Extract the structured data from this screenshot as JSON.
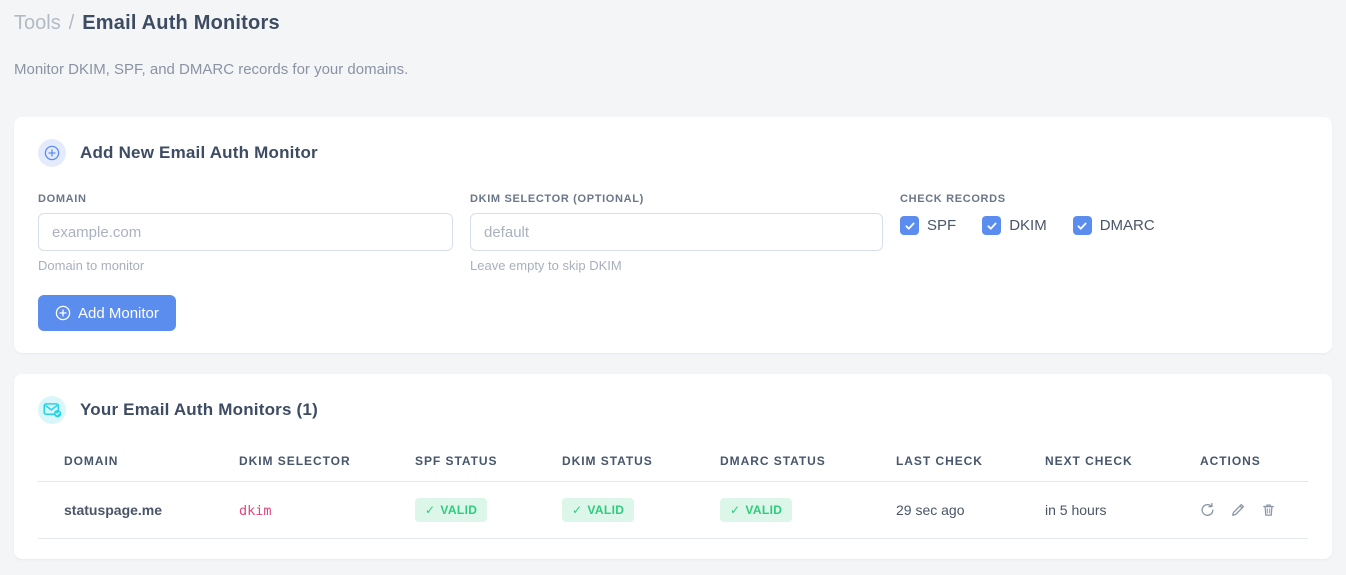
{
  "header": {
    "breadcrumb_section": "Tools",
    "breadcrumb_separator": "/",
    "breadcrumb_current": "Email Auth Monitors",
    "subtitle": "Monitor DKIM, SPF, and DMARC records for your domains."
  },
  "add_monitor_card": {
    "title": "Add New Email Auth Monitor",
    "title_icon": "plus-circle",
    "domain_field": {
      "label": "DOMAIN",
      "placeholder": "example.com",
      "value": "",
      "helper": "Domain to monitor"
    },
    "dkim_field": {
      "label": "DKIM SELECTOR (OPTIONAL)",
      "placeholder": "default",
      "value": "",
      "helper": "Leave empty to skip DKIM"
    },
    "check_records": {
      "label": "CHECK RECORDS",
      "options": [
        {
          "label": "SPF",
          "checked": true
        },
        {
          "label": "DKIM",
          "checked": true
        },
        {
          "label": "DMARC",
          "checked": true
        }
      ]
    },
    "submit_label": "Add Monitor",
    "submit_icon": "plus-circle"
  },
  "monitors_card": {
    "title": "Your Email Auth Monitors (1)",
    "title_icon": "envelope-check",
    "table": {
      "columns": [
        "DOMAIN",
        "DKIM SELECTOR",
        "SPF STATUS",
        "DKIM STATUS",
        "DMARC STATUS",
        "LAST CHECK",
        "NEXT CHECK",
        "ACTIONS"
      ],
      "rows": [
        {
          "domain": "statuspage.me",
          "dkim_selector": "dkim",
          "spf_status": "VALID",
          "dkim_status": "VALID",
          "dmarc_status": "VALID",
          "last_check": "29 sec ago",
          "next_check": "in 5 hours",
          "action_icons": [
            "refresh",
            "pencil",
            "trash"
          ]
        }
      ]
    }
  },
  "icons": {
    "check": "✓"
  },
  "colors": {
    "accent": "#5b8def",
    "accent-bg": "#e4ebfc",
    "success": "#2ecb7f",
    "success-bg": "#dcf7e9",
    "code-pink": "#e1467c",
    "cyan": "#25d3e6",
    "cyan-bg": "#d9f6fa"
  }
}
